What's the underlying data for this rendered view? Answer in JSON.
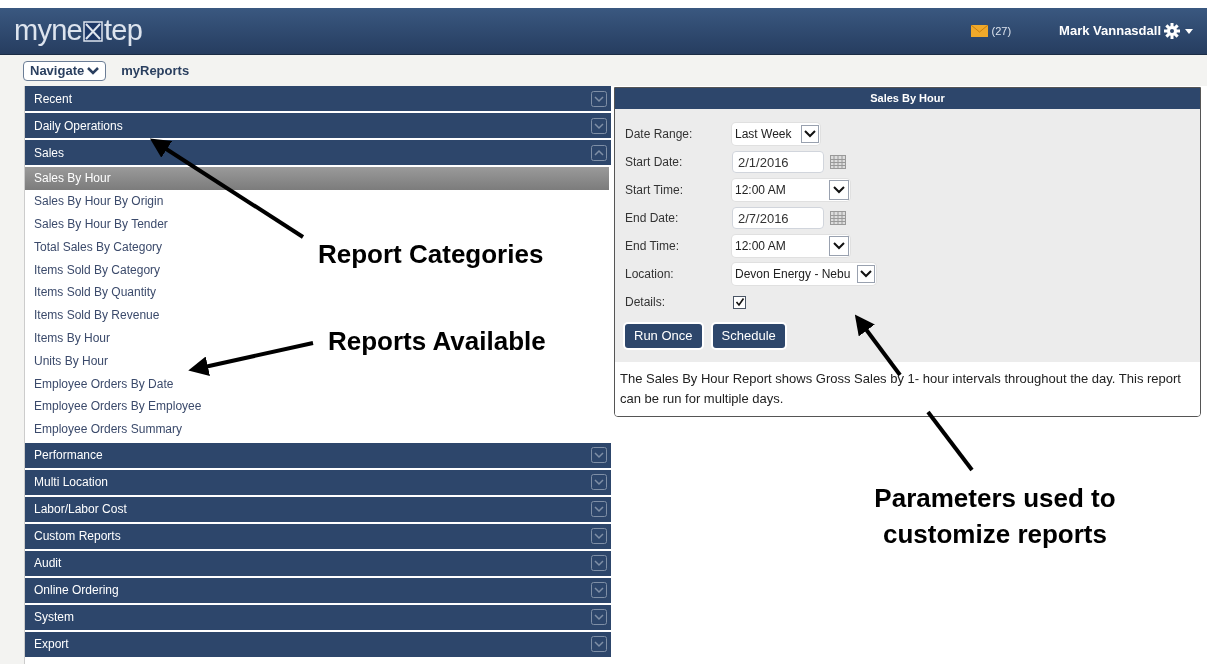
{
  "header": {
    "logo": {
      "prefix": "myne",
      "suffix": "tep"
    },
    "messages": {
      "count": "(27)"
    },
    "user": {
      "name": "Mark Vannasdall"
    }
  },
  "nav": {
    "menu": "Navigate",
    "breadcrumb": "myReports"
  },
  "categories": [
    {
      "label": "Recent",
      "expanded": false
    },
    {
      "label": "Daily Operations",
      "expanded": false
    },
    {
      "label": "Sales",
      "expanded": true,
      "items": [
        {
          "label": "Sales By Hour",
          "selected": true
        },
        {
          "label": "Sales By Hour By Origin",
          "selected": false
        },
        {
          "label": "Sales By Hour By Tender",
          "selected": false
        },
        {
          "label": "Total Sales By Category",
          "selected": false
        },
        {
          "label": "Items Sold By Category",
          "selected": false
        },
        {
          "label": "Items Sold By Quantity",
          "selected": false
        },
        {
          "label": "Items Sold By Revenue",
          "selected": false
        },
        {
          "label": "Items By Hour",
          "selected": false
        },
        {
          "label": "Units By Hour",
          "selected": false
        },
        {
          "label": "Employee Orders By Date",
          "selected": false
        },
        {
          "label": "Employee Orders By Employee",
          "selected": false
        },
        {
          "label": "Employee Orders Summary",
          "selected": false
        }
      ]
    },
    {
      "label": "Performance",
      "expanded": false
    },
    {
      "label": "Multi Location",
      "expanded": false
    },
    {
      "label": "Labor/Labor Cost",
      "expanded": false
    },
    {
      "label": "Custom Reports",
      "expanded": false
    },
    {
      "label": "Audit",
      "expanded": false
    },
    {
      "label": "Online Ordering",
      "expanded": false
    },
    {
      "label": "System",
      "expanded": false
    },
    {
      "label": "Export",
      "expanded": false
    }
  ],
  "report": {
    "title": "Sales By Hour",
    "fields": [
      {
        "kind": "select",
        "label": "Date Range:",
        "value": "Last Week"
      },
      {
        "kind": "date",
        "label": "Start Date:",
        "value": "2/1/2016"
      },
      {
        "kind": "select",
        "label": "Start Time:",
        "value": "12:00 AM"
      },
      {
        "kind": "date",
        "label": "End Date:",
        "value": "2/7/2016"
      },
      {
        "kind": "select",
        "label": "End Time:",
        "value": "12:00 AM"
      },
      {
        "kind": "select",
        "label": "Location:",
        "value": "Devon Energy - Nebu"
      },
      {
        "kind": "checkbox",
        "label": "Details:",
        "checked": true
      }
    ],
    "buttons": [
      "Run Once",
      "Schedule"
    ],
    "description": "The Sales By Hour Report shows Gross Sales by 1- hour intervals throughout the day. This report can be run for multiple days."
  },
  "annotations": [
    {
      "text": "Report Categories"
    },
    {
      "text": "Reports Available"
    },
    {
      "text": "Parameters used to customize reports"
    }
  ]
}
